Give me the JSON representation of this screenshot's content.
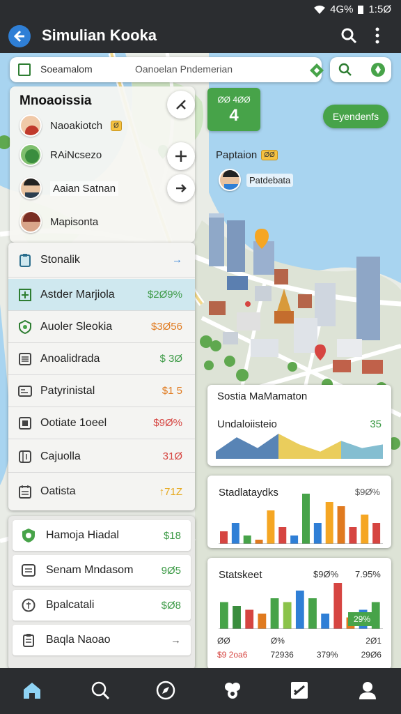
{
  "status_bar": {
    "signal": "4G%",
    "time": "1:5Ø"
  },
  "app_bar": {
    "title": "Simulian Kooka"
  },
  "search": {
    "label": "Soeamalom",
    "placeholder": "Oanoelan Pndemerian"
  },
  "people_panel": {
    "title": "Mnoaoissia",
    "people": [
      {
        "name": "Naoakiotch",
        "badge": "Ø",
        "avatar_color": "#c0392b"
      },
      {
        "name": "RAiNcsezo",
        "avatar_color": "#3a8d3e"
      },
      {
        "name": "Aaian Satnan",
        "avatar_color": "#2c3e50"
      },
      {
        "name": "Mapisonta",
        "avatar_color": "#b0413e"
      }
    ]
  },
  "map": {
    "green_box_text": "ØØ 4ØØ",
    "green_box_value": "4",
    "pill_button": "Eyendenfs",
    "label": "Paptaion",
    "label_badge": "ØØ",
    "person_tag": "Patdebata"
  },
  "list_primary": {
    "items": [
      {
        "name": "Stonalik",
        "value": "→",
        "icon": "clipboard-icon",
        "value_color": "#2f7fd6"
      },
      {
        "name": "Astder Marjiola",
        "value": "$2Ø9%",
        "icon": "grid-icon",
        "value_color": "#3c9a46",
        "selected": true
      },
      {
        "name": "Auoler Sleokia",
        "value": "$3Ø56",
        "icon": "shield-icon",
        "value_color": "#e07a1f"
      },
      {
        "name": "Anoalidrada",
        "value": "$ 3Ø",
        "icon": "document-icon",
        "value_color": "#3c9a46"
      },
      {
        "name": "Patyrinistal",
        "value": "$1 5",
        "icon": "id-card-icon",
        "value_color": "#e07a1f"
      },
      {
        "name": "Ootiate 1oeel",
        "value": "$9Ø%",
        "icon": "square-icon",
        "value_color": "#d64541"
      },
      {
        "name": "Cajuolla",
        "value": "31Ø",
        "icon": "book-icon",
        "value_color": "#d64541"
      },
      {
        "name": "Oatista",
        "value": "↑71Z",
        "icon": "calendar-icon",
        "value_color": "#e6a91f"
      }
    ]
  },
  "list_secondary": {
    "items": [
      {
        "name": "Hamoja Hiadal",
        "value": "$18",
        "icon": "shield-icon",
        "value_color": "#3c9a46"
      },
      {
        "name": "Senam Mndasom",
        "value": "9Ø5",
        "icon": "list-icon",
        "value_color": "#3c9a46"
      },
      {
        "name": "Bpalcatali",
        "value": "$Ø8",
        "icon": "coin-icon",
        "value_color": "#3c9a46"
      },
      {
        "name": "Baqla Naoao",
        "value": "→",
        "icon": "clipboard-icon",
        "value_color": "#555"
      }
    ]
  },
  "panel_area": {
    "title": "Sostia MaMamaton",
    "subtitle": "Undaloiisteio",
    "value": "35"
  },
  "panel_bar1": {
    "title": "Stadlataydks",
    "value": "$9Ø%"
  },
  "panel_bar2": {
    "title": "Statskeet",
    "val1": "$9Ø%",
    "val2": "7.95%",
    "highlight": "29%",
    "foot_top": [
      "ØØ",
      "Ø%",
      "",
      "2Ø1"
    ],
    "foot_bottom": [
      "$9 2oa6",
      "72936",
      "379%",
      "29Ø6"
    ]
  },
  "colors": {
    "accent_green": "#47a349",
    "accent_blue": "#2f7fd6",
    "bar_dark": "#2b2d30"
  },
  "chart_data": [
    {
      "type": "area",
      "title": "Sostia MaMamaton",
      "subtitle": "Undaloiisteio",
      "series": [
        {
          "values": [
            2,
            6,
            3,
            7,
            4,
            2,
            5,
            3,
            4
          ]
        }
      ]
    },
    {
      "type": "bar",
      "title": "Stadlataydks",
      "values": [
        3,
        5,
        2,
        1,
        8,
        4,
        2,
        12,
        5,
        10,
        9,
        4,
        7,
        5
      ],
      "colors": [
        "#d64541",
        "#2f7fd6",
        "#47a349",
        "#e07a1f",
        "#f5a623",
        "#d64541",
        "#2f7fd6",
        "#47a349",
        "#2f7fd6",
        "#f5a623",
        "#e07a1f",
        "#d64541",
        "#f5a623",
        "#d64541"
      ]
    },
    {
      "type": "bar",
      "title": "Statskeet",
      "values": [
        7,
        6,
        5,
        4,
        8,
        7,
        10,
        8,
        4,
        12,
        3,
        5,
        7
      ],
      "colors": [
        "#47a349",
        "#3a8d3e",
        "#d64541",
        "#e07a1f",
        "#47a349",
        "#8bc34a",
        "#2f7fd6",
        "#47a349",
        "#2f7fd6",
        "#d64541",
        "#e07a1f",
        "#2f7fd6",
        "#47a349"
      ]
    }
  ]
}
